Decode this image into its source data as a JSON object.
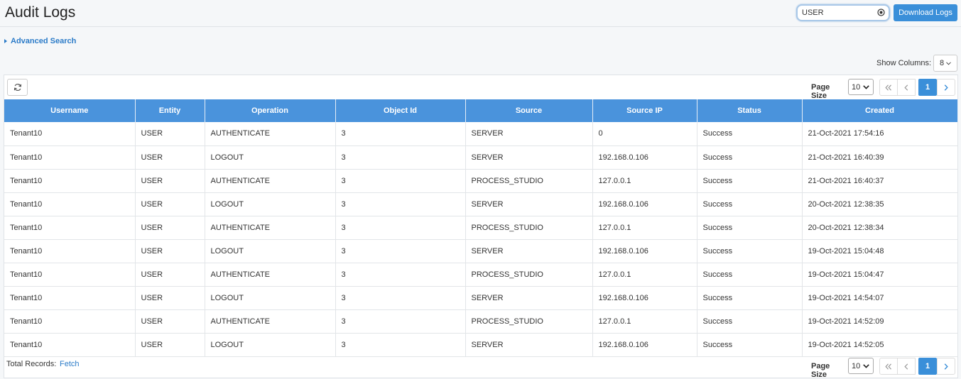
{
  "header": {
    "title": "Audit Logs",
    "search_value": "USER",
    "download_label": "Download Logs"
  },
  "advanced_search_label": "Advanced Search",
  "show_columns": {
    "label": "Show Columns:",
    "value": "8"
  },
  "pager": {
    "page_size_label": "Page Size",
    "page_size": "10",
    "current_page": "1"
  },
  "table": {
    "columns": [
      "Username",
      "Entity",
      "Operation",
      "Object Id",
      "Source",
      "Source IP",
      "Status",
      "Created"
    ],
    "rows": [
      [
        "Tenant10",
        "USER",
        "AUTHENTICATE",
        "3",
        "SERVER",
        "0",
        "Success",
        "21-Oct-2021 17:54:16"
      ],
      [
        "Tenant10",
        "USER",
        "LOGOUT",
        "3",
        "SERVER",
        "192.168.0.106",
        "Success",
        "21-Oct-2021 16:40:39"
      ],
      [
        "Tenant10",
        "USER",
        "AUTHENTICATE",
        "3",
        "PROCESS_STUDIO",
        "127.0.0.1",
        "Success",
        "21-Oct-2021 16:40:37"
      ],
      [
        "Tenant10",
        "USER",
        "LOGOUT",
        "3",
        "SERVER",
        "192.168.0.106",
        "Success",
        "20-Oct-2021 12:38:35"
      ],
      [
        "Tenant10",
        "USER",
        "AUTHENTICATE",
        "3",
        "PROCESS_STUDIO",
        "127.0.0.1",
        "Success",
        "20-Oct-2021 12:38:34"
      ],
      [
        "Tenant10",
        "USER",
        "LOGOUT",
        "3",
        "SERVER",
        "192.168.0.106",
        "Success",
        "19-Oct-2021 15:04:48"
      ],
      [
        "Tenant10",
        "USER",
        "AUTHENTICATE",
        "3",
        "PROCESS_STUDIO",
        "127.0.0.1",
        "Success",
        "19-Oct-2021 15:04:47"
      ],
      [
        "Tenant10",
        "USER",
        "LOGOUT",
        "3",
        "SERVER",
        "192.168.0.106",
        "Success",
        "19-Oct-2021 14:54:07"
      ],
      [
        "Tenant10",
        "USER",
        "AUTHENTICATE",
        "3",
        "PROCESS_STUDIO",
        "127.0.0.1",
        "Success",
        "19-Oct-2021 14:52:09"
      ],
      [
        "Tenant10",
        "USER",
        "LOGOUT",
        "3",
        "SERVER",
        "192.168.0.106",
        "Success",
        "19-Oct-2021 14:52:05"
      ]
    ]
  },
  "footer": {
    "total_label": "Total Records:",
    "fetch_label": "Fetch"
  },
  "colors": {
    "accent": "#3a8fd9",
    "header_bg": "#4a93dc",
    "link": "#2b7bc8"
  }
}
